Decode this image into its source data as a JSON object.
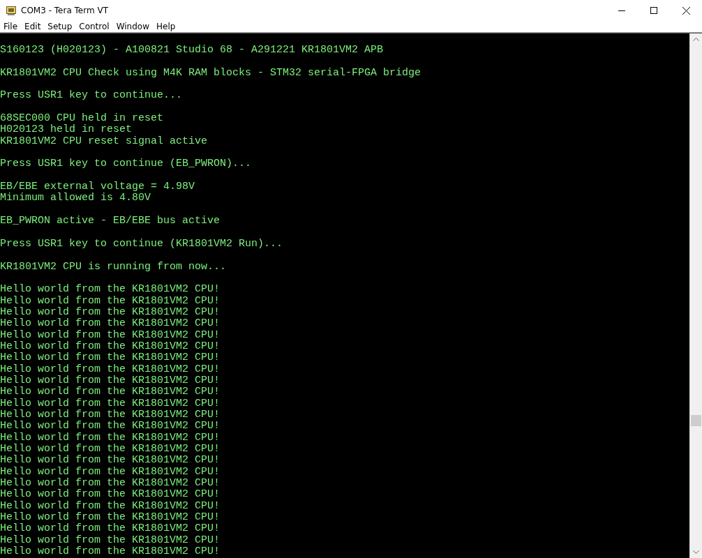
{
  "window": {
    "title": "COM3 - Tera Term VT"
  },
  "menu": [
    "File",
    "Edit",
    "Setup",
    "Control",
    "Window",
    "Help"
  ],
  "terminal": {
    "blocks": [
      [
        "S160123 (H020123) - A100821 Studio 68 - A291221 KR1801VM2 APB"
      ],
      [
        "KR1801VM2 CPU Check using M4K RAM blocks - STM32 serial-FPGA bridge"
      ],
      [
        "Press USR1 key to continue..."
      ],
      [
        "68SEC000 CPU held in reset",
        "H020123 held in reset",
        "KR1801VM2 CPU reset signal active"
      ],
      [
        "Press USR1 key to continue (EB_PWRON)..."
      ],
      [
        "EB/EBE external voltage = 4.98V",
        "Minimum allowed is 4.80V"
      ],
      [
        "EB_PWRON active - EB/EBE bus active"
      ],
      [
        "Press USR1 key to continue (KR1801VM2 Run)..."
      ],
      [
        "KR1801VM2 CPU is running from now..."
      ],
      [
        "Hello world from the KR1801VM2 CPU!",
        "Hello world from the KR1801VM2 CPU!",
        "Hello world from the KR1801VM2 CPU!",
        "Hello world from the KR1801VM2 CPU!",
        "Hello world from the KR1801VM2 CPU!",
        "Hello world from the KR1801VM2 CPU!",
        "Hello world from the KR1801VM2 CPU!",
        "Hello world from the KR1801VM2 CPU!",
        "Hello world from the KR1801VM2 CPU!",
        "Hello world from the KR1801VM2 CPU!",
        "Hello world from the KR1801VM2 CPU!",
        "Hello world from the KR1801VM2 CPU!",
        "Hello world from the KR1801VM2 CPU!",
        "Hello world from the KR1801VM2 CPU!",
        "Hello world from the KR1801VM2 CPU!",
        "Hello world from the KR1801VM2 CPU!",
        "Hello world from the KR1801VM2 CPU!",
        "Hello world from the KR1801VM2 CPU!",
        "Hello world from the KR1801VM2 CPU!",
        "Hello world from the KR1801VM2 CPU!",
        "Hello world from the KR1801VM2 CPU!",
        "Hello world from the KR1801VM2 CPU!",
        "Hello world from the KR1801VM2 CPU!",
        "Hello world from the KR1801VM2 CPU!"
      ]
    ]
  }
}
